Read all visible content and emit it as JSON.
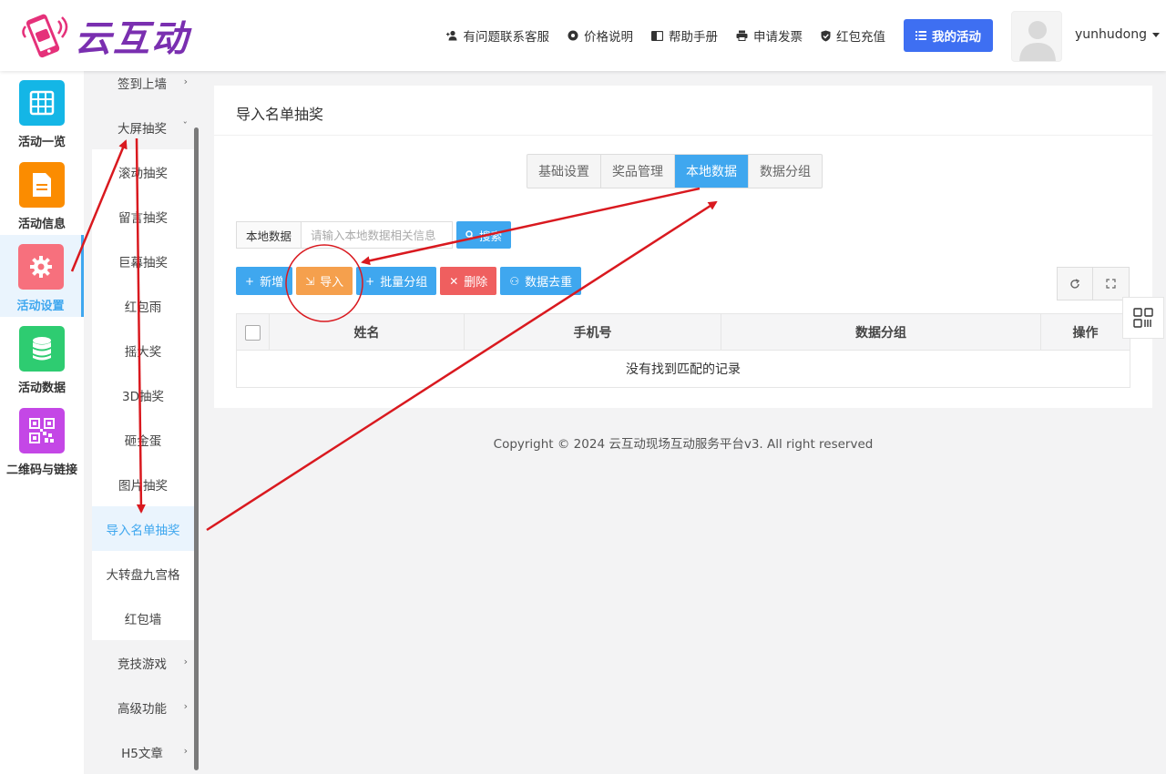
{
  "brand": {
    "name": "云互动"
  },
  "header": {
    "links": [
      {
        "label": "有问题联系客服",
        "icon": "add-user-icon"
      },
      {
        "label": "价格说明",
        "icon": "settings-icon"
      },
      {
        "label": "帮助手册",
        "icon": "book-icon"
      },
      {
        "label": "申请发票",
        "icon": "printer-icon"
      },
      {
        "label": "红包充值",
        "icon": "shield-check-icon"
      }
    ],
    "primary_button": "我的活动",
    "username": "yunhudong"
  },
  "icon_sidebar": {
    "items": [
      {
        "label": "活动一览",
        "color": "#14b6e6",
        "icon": "grid-icon"
      },
      {
        "label": "活动信息",
        "color": "#fb8c00",
        "icon": "document-icon"
      },
      {
        "label": "活动设置",
        "color": "#f7707d",
        "icon": "gear-icon",
        "active": true
      },
      {
        "label": "活动数据",
        "color": "#2ecc71",
        "icon": "database-icon"
      },
      {
        "label": "二维码与链接",
        "color": "#c447e6",
        "icon": "qrcode-icon"
      }
    ]
  },
  "sub_menu": {
    "items": [
      {
        "label": "签到上墙",
        "type": "parent",
        "chevron": "›"
      },
      {
        "label": "大屏抽奖",
        "type": "parent",
        "chevron": "ˇ"
      },
      {
        "label": "滚动抽奖",
        "type": "child"
      },
      {
        "label": "留言抽奖",
        "type": "child"
      },
      {
        "label": "巨幕抽奖",
        "type": "child"
      },
      {
        "label": "红包雨",
        "type": "child"
      },
      {
        "label": "摇大奖",
        "type": "child"
      },
      {
        "label": "3D抽奖",
        "type": "child"
      },
      {
        "label": "砸金蛋",
        "type": "child"
      },
      {
        "label": "图片抽奖",
        "type": "child"
      },
      {
        "label": "导入名单抽奖",
        "type": "child",
        "active": true
      },
      {
        "label": "大转盘九宫格",
        "type": "child"
      },
      {
        "label": "红包墙",
        "type": "child"
      },
      {
        "label": "竞技游戏",
        "type": "parent",
        "chevron": "›"
      },
      {
        "label": "高级功能",
        "type": "parent",
        "chevron": "›"
      },
      {
        "label": "H5文章",
        "type": "parent",
        "chevron": "›"
      }
    ]
  },
  "main": {
    "title": "导入名单抽奖",
    "tabs": [
      {
        "label": "基础设置"
      },
      {
        "label": "奖品管理"
      },
      {
        "label": "本地数据",
        "active": true
      },
      {
        "label": "数据分组"
      }
    ],
    "search": {
      "label": "本地数据",
      "placeholder": "请输入本地数据相关信息",
      "button": "搜索"
    },
    "actions": [
      {
        "label": "新增",
        "glyph": "+",
        "style": "blue"
      },
      {
        "label": "导入",
        "glyph": "⇲",
        "style": "orange"
      },
      {
        "label": "批量分组",
        "glyph": "+",
        "style": "blue"
      },
      {
        "label": "删除",
        "glyph": "✕",
        "style": "red"
      },
      {
        "label": "数据去重",
        "glyph": "⚇",
        "style": "blue"
      }
    ],
    "table": {
      "columns": [
        "姓名",
        "手机号",
        "数据分组",
        "操作"
      ],
      "empty_text": "没有找到匹配的记录"
    }
  },
  "footer": {
    "copyright": "Copyright © 2024 云互动现场互动服务平台v3. All right reserved"
  },
  "colors": {
    "accent": "#3fa7ef",
    "primary": "#3e6ff2",
    "brand": "#7a2fb0",
    "annotation": "#d9191f"
  }
}
